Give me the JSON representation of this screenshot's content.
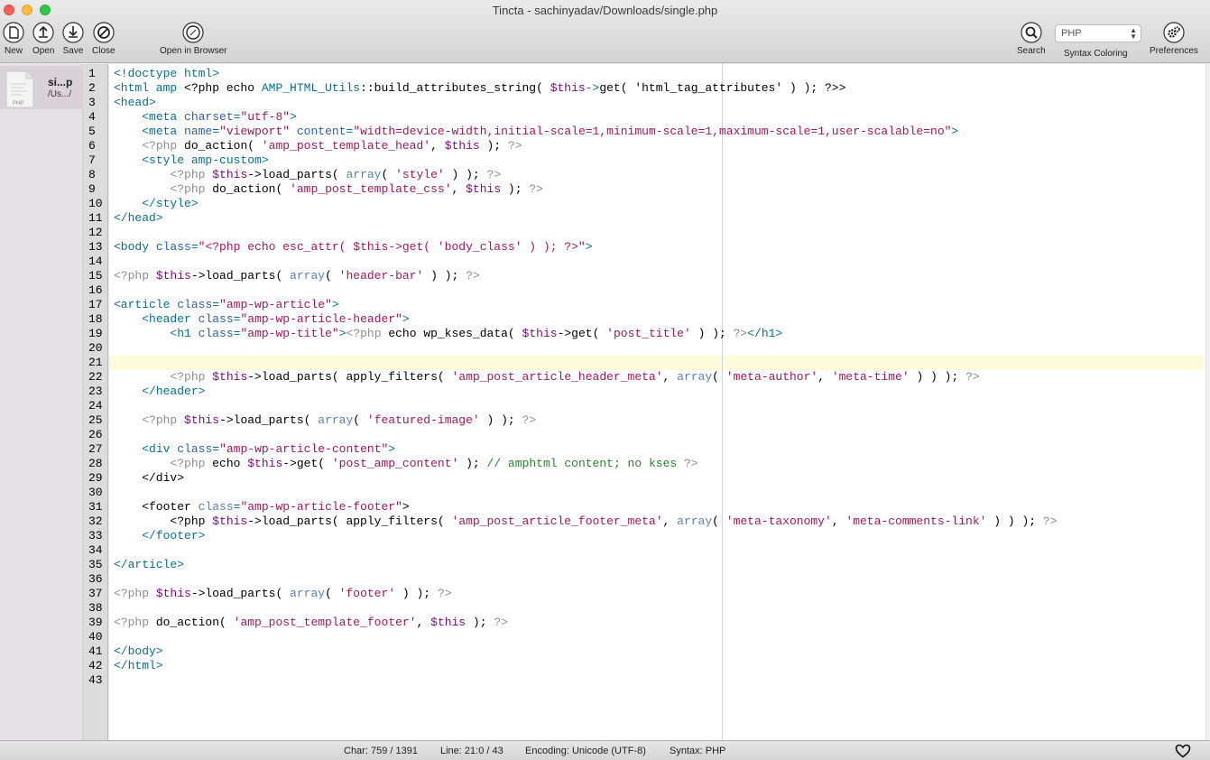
{
  "window": {
    "title": "Tincta - sachinyadav/Downloads/single.php"
  },
  "toolbar": {
    "new_label": "New",
    "open_label": "Open",
    "save_label": "Save",
    "close_label": "Close",
    "open_browser_label": "Open in Browser",
    "search_label": "Search",
    "syntax_coloring_label": "Syntax Coloring",
    "preferences_label": "Preferences",
    "language_value": "PHP"
  },
  "sidebar": {
    "file": {
      "name": "si...p",
      "path": "/Us.../",
      "icon_label": "PHP"
    }
  },
  "editor": {
    "line_count": 43,
    "current_line": 21,
    "lines": [
      [
        [
          "tag",
          "<!doctype html>"
        ]
      ],
      [
        [
          "tag",
          "<html amp "
        ],
        [
          "plain",
          "<?php echo "
        ],
        [
          "tag",
          "AMP_HTML_Utils"
        ],
        [
          "plain",
          "::build_attributes_string( "
        ],
        [
          "var",
          "$this"
        ],
        [
          "tag",
          "->"
        ],
        [
          "plain",
          "get( 'html_tag_attributes' ) ); ?>>"
        ]
      ],
      [
        [
          "tag",
          "<head>"
        ]
      ],
      [
        [
          "plain",
          "    "
        ],
        [
          "tag",
          "<meta "
        ],
        [
          "attr",
          "charset"
        ],
        [
          "tag",
          "="
        ],
        [
          "str",
          "\"utf-8\""
        ],
        [
          "tag",
          ">"
        ]
      ],
      [
        [
          "plain",
          "    "
        ],
        [
          "tag",
          "<meta "
        ],
        [
          "attr",
          "name"
        ],
        [
          "tag",
          "="
        ],
        [
          "str",
          "\"viewport\""
        ],
        [
          "attr",
          " content"
        ],
        [
          "tag",
          "="
        ],
        [
          "str",
          "\"width=device-width,initial-scale=1,minimum-scale=1,maximum-scale=1,user-scalable=no\""
        ],
        [
          "tag",
          ">"
        ]
      ],
      [
        [
          "plain",
          "    "
        ],
        [
          "php",
          "<?php "
        ],
        [
          "plain",
          "do_action( "
        ],
        [
          "str",
          "'amp_post_template_head'"
        ],
        [
          "plain",
          ", "
        ],
        [
          "var",
          "$this"
        ],
        [
          "plain",
          " ); "
        ],
        [
          "php",
          "?>"
        ]
      ],
      [
        [
          "plain",
          "    "
        ],
        [
          "tag",
          "<style amp-custom>"
        ]
      ],
      [
        [
          "plain",
          "        "
        ],
        [
          "php",
          "<?php "
        ],
        [
          "var",
          "$this"
        ],
        [
          "plain",
          "->load_parts( "
        ],
        [
          "kw",
          "array"
        ],
        [
          "plain",
          "( "
        ],
        [
          "str",
          "'style'"
        ],
        [
          "plain",
          " ) ); "
        ],
        [
          "php",
          "?>"
        ]
      ],
      [
        [
          "plain",
          "        "
        ],
        [
          "php",
          "<?php "
        ],
        [
          "plain",
          "do_action( "
        ],
        [
          "str",
          "'amp_post_template_css'"
        ],
        [
          "plain",
          ", "
        ],
        [
          "var",
          "$this"
        ],
        [
          "plain",
          " ); "
        ],
        [
          "php",
          "?>"
        ]
      ],
      [
        [
          "plain",
          "    "
        ],
        [
          "tag",
          "</style>"
        ]
      ],
      [
        [
          "tag",
          "</head>"
        ]
      ],
      [],
      [
        [
          "tag",
          "<body "
        ],
        [
          "attr",
          "class"
        ],
        [
          "tag",
          "="
        ],
        [
          "str",
          "\"<?php echo esc_attr( $this->get( 'body_class' ) ); ?>\""
        ],
        [
          "tag",
          ">"
        ]
      ],
      [],
      [
        [
          "php",
          "<?php "
        ],
        [
          "var",
          "$this"
        ],
        [
          "plain",
          "->load_parts( "
        ],
        [
          "kw",
          "array"
        ],
        [
          "plain",
          "( "
        ],
        [
          "str",
          "'header-bar'"
        ],
        [
          "plain",
          " ) ); "
        ],
        [
          "php",
          "?>"
        ]
      ],
      [],
      [
        [
          "tag",
          "<article "
        ],
        [
          "attr",
          "class"
        ],
        [
          "tag",
          "="
        ],
        [
          "str",
          "\"amp-wp-article\""
        ],
        [
          "tag",
          ">"
        ]
      ],
      [
        [
          "plain",
          "    "
        ],
        [
          "tag",
          "<header "
        ],
        [
          "attr",
          "class"
        ],
        [
          "tag",
          "="
        ],
        [
          "str",
          "\"amp-wp-article-header\""
        ],
        [
          "tag",
          ">"
        ]
      ],
      [
        [
          "plain",
          "        "
        ],
        [
          "tag",
          "<h1 "
        ],
        [
          "attr",
          "class"
        ],
        [
          "tag",
          "="
        ],
        [
          "str",
          "\"amp-wp-title\""
        ],
        [
          "tag",
          ">"
        ],
        [
          "php",
          "<?php "
        ],
        [
          "plain",
          "echo wp_kses_data( "
        ],
        [
          "var",
          "$this"
        ],
        [
          "plain",
          "->get( "
        ],
        [
          "str",
          "'post_title'"
        ],
        [
          "plain",
          " ) ); "
        ],
        [
          "php",
          "?>"
        ],
        [
          "tag",
          "</h1>"
        ]
      ],
      [],
      [],
      [
        [
          "plain",
          "        "
        ],
        [
          "php",
          "<?php "
        ],
        [
          "var",
          "$this"
        ],
        [
          "plain",
          "->load_parts( apply_filters( "
        ],
        [
          "str",
          "'amp_post_article_header_meta'"
        ],
        [
          "plain",
          ", "
        ],
        [
          "kw",
          "array"
        ],
        [
          "plain",
          "( "
        ],
        [
          "str",
          "'meta-author'"
        ],
        [
          "plain",
          ", "
        ],
        [
          "str",
          "'meta-time'"
        ],
        [
          "plain",
          " ) ) ); "
        ],
        [
          "php",
          "?>"
        ]
      ],
      [
        [
          "plain",
          "    "
        ],
        [
          "tag",
          "</header>"
        ]
      ],
      [],
      [
        [
          "plain",
          "    "
        ],
        [
          "php",
          "<?php "
        ],
        [
          "var",
          "$this"
        ],
        [
          "plain",
          "->load_parts( "
        ],
        [
          "kw",
          "array"
        ],
        [
          "plain",
          "( "
        ],
        [
          "str",
          "'featured-image'"
        ],
        [
          "plain",
          " ) ); "
        ],
        [
          "php",
          "?>"
        ]
      ],
      [],
      [
        [
          "plain",
          "    "
        ],
        [
          "tag",
          "<div "
        ],
        [
          "attr",
          "class"
        ],
        [
          "tag",
          "="
        ],
        [
          "str",
          "\"amp-wp-article-content\""
        ],
        [
          "tag",
          ">"
        ]
      ],
      [
        [
          "plain",
          "        "
        ],
        [
          "php",
          "<?php "
        ],
        [
          "plain",
          "echo "
        ],
        [
          "var",
          "$this"
        ],
        [
          "plain",
          "->get( "
        ],
        [
          "str",
          "'post_amp_content'"
        ],
        [
          "plain",
          " ); "
        ],
        [
          "cm",
          "// amphtml content; no kses "
        ],
        [
          "php",
          "?>"
        ]
      ],
      [
        [
          "plain",
          "    </div>"
        ]
      ],
      [],
      [
        [
          "plain",
          "    <footer "
        ],
        [
          "kw",
          "class"
        ],
        [
          "tag",
          "="
        ],
        [
          "str",
          "\"amp-wp-article-footer\""
        ],
        [
          "plain",
          ">"
        ]
      ],
      [
        [
          "plain",
          "        <?php "
        ],
        [
          "var",
          "$this"
        ],
        [
          "plain",
          "->load_parts( apply_filters( "
        ],
        [
          "str",
          "'amp_post_article_footer_meta'"
        ],
        [
          "plain",
          ", "
        ],
        [
          "kw",
          "array"
        ],
        [
          "plain",
          "( "
        ],
        [
          "str",
          "'meta-taxonomy'"
        ],
        [
          "plain",
          ", "
        ],
        [
          "str",
          "'meta-comments-link'"
        ],
        [
          "plain",
          " ) ) ); "
        ],
        [
          "php",
          "?>"
        ]
      ],
      [
        [
          "plain",
          "    "
        ],
        [
          "tag",
          "</footer>"
        ]
      ],
      [],
      [
        [
          "tag",
          "</article>"
        ]
      ],
      [],
      [
        [
          "php",
          "<?php "
        ],
        [
          "var",
          "$this"
        ],
        [
          "plain",
          "->load_parts( "
        ],
        [
          "kw",
          "array"
        ],
        [
          "plain",
          "( "
        ],
        [
          "str",
          "'footer'"
        ],
        [
          "plain",
          " ) ); "
        ],
        [
          "php",
          "?>"
        ]
      ],
      [],
      [
        [
          "php",
          "<?php "
        ],
        [
          "plain",
          "do_action( "
        ],
        [
          "str",
          "'amp_post_template_footer'"
        ],
        [
          "plain",
          ", "
        ],
        [
          "var",
          "$this"
        ],
        [
          "plain",
          " ); "
        ],
        [
          "php",
          "?>"
        ]
      ],
      [],
      [
        [
          "tag",
          "</body>"
        ]
      ],
      [
        [
          "tag",
          "</html>"
        ]
      ],
      []
    ]
  },
  "statusbar": {
    "char": "Char: 759 / 1391",
    "line": "Line: 21:0 / 43",
    "encoding": "Encoding: Unicode (UTF-8)",
    "syntax": "Syntax: PHP"
  },
  "icons": {
    "new": "new-document-icon",
    "open": "open-upload-icon",
    "save": "save-download-icon",
    "close": "close-circle-icon",
    "browser": "compass-icon",
    "search": "magnifier-icon",
    "preferences": "gears-icon",
    "favorite": "heart-icon"
  }
}
